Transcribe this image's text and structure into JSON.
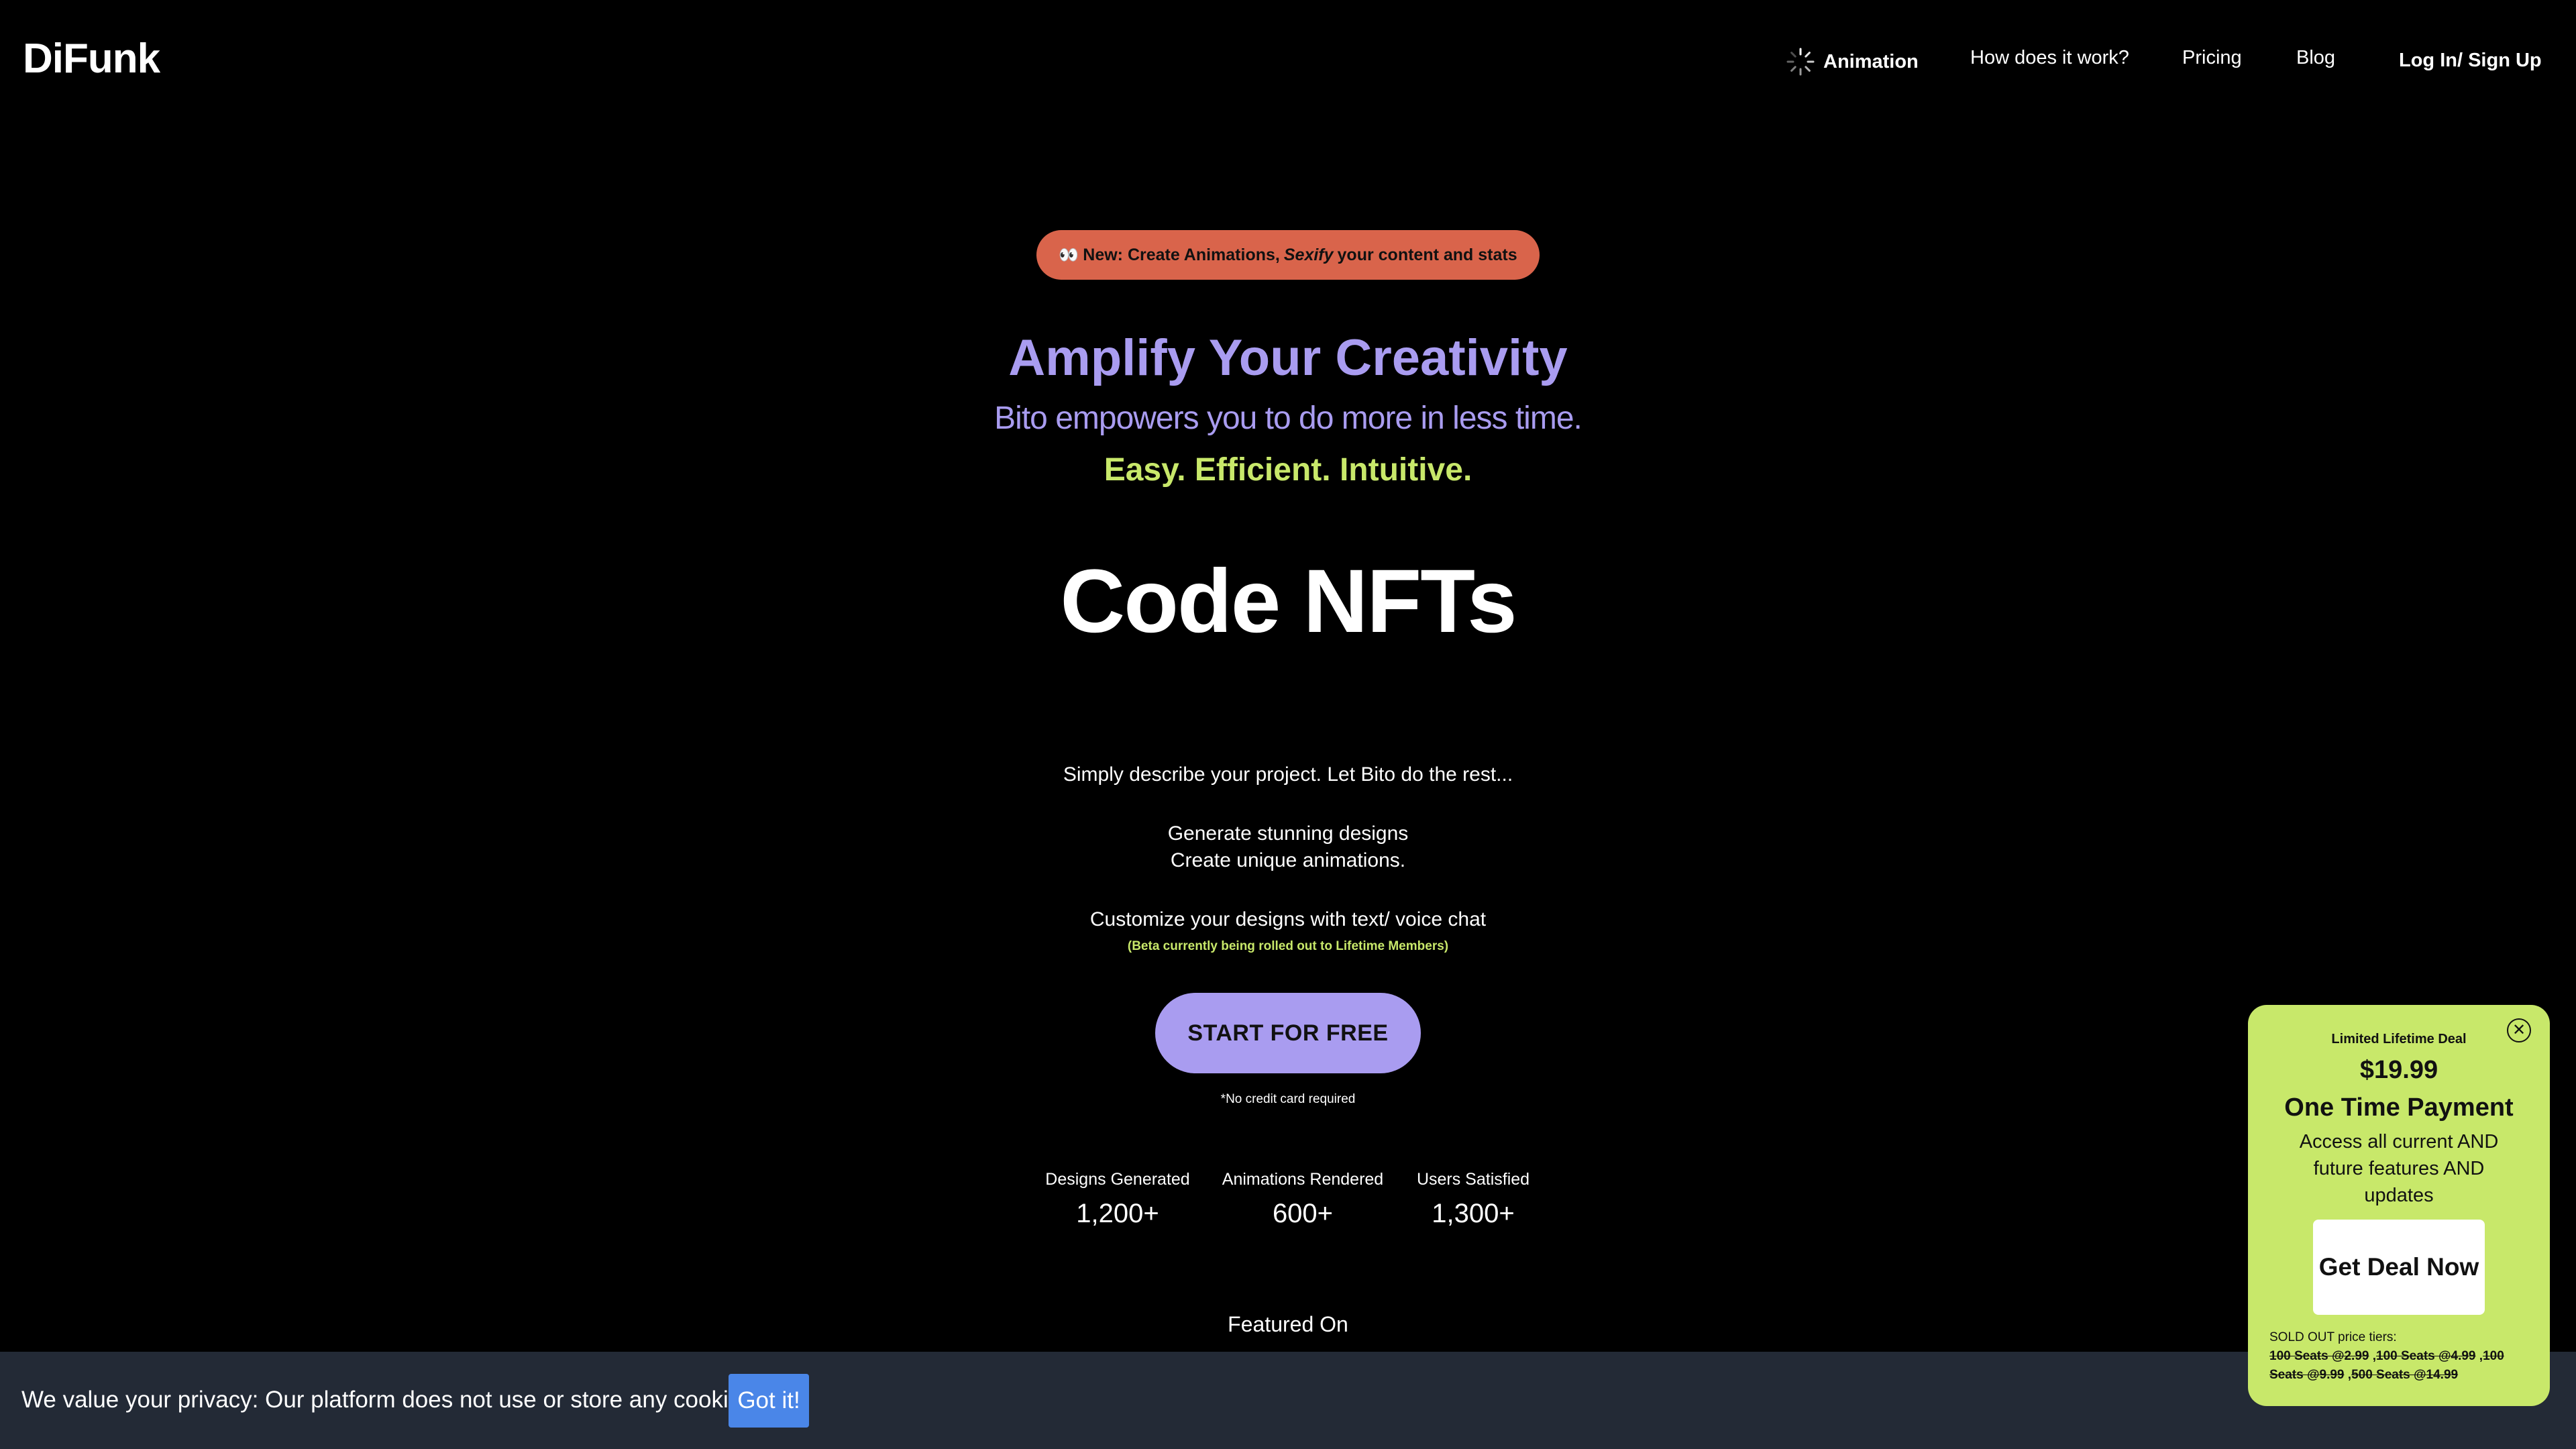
{
  "header": {
    "logo": "DiFunk",
    "nav": {
      "animation": "Animation",
      "how": "How does it work?",
      "pricing": "Pricing",
      "blog": "Blog",
      "login": "Log In/ Sign Up"
    }
  },
  "hero": {
    "pill": {
      "icon": "👀",
      "pre": "New: Create Animations,",
      "em": "Sexify",
      "post": "your content and stats"
    },
    "title": "Amplify Your Creativity",
    "subtitle": "Bito empowers you to do more in less time.",
    "tagline": "Easy. Efficient. Intuitive.",
    "rotating": "Code NFTs",
    "line1": "Simply describe your project. Let Bito do the rest...",
    "line2": "Generate stunning designs",
    "line3": "Create unique animations.",
    "line4": "Customize your designs with text/ voice chat",
    "beta": "(Beta currently being rolled out to Lifetime Members)",
    "cta": "START FOR FREE",
    "no_cc": "*No credit card required"
  },
  "stats": [
    {
      "label": "Designs Generated",
      "value": "1,200+"
    },
    {
      "label": "Animations Rendered",
      "value": "600+"
    },
    {
      "label": "Users Satisfied",
      "value": "1,300+"
    }
  ],
  "featured": "Featured On",
  "cookie": {
    "text": "We value your privacy: Our platform does not use or store any cookies.",
    "button": "Got it!"
  },
  "deal": {
    "close": "✕",
    "label": "Limited Lifetime Deal",
    "price": "$19.99",
    "payment": "One Time Payment",
    "desc": "Access all current AND future features AND updates",
    "button": "Get Deal Now",
    "sold_label": "SOLD OUT price tiers:",
    "tiers": [
      "100 Seats @2.99",
      "100 Seats @4.99",
      "100 Seats @9.99",
      "500 Seats @14.99"
    ]
  },
  "colors": {
    "accent_purple": "#a99cf0",
    "accent_green": "#c8e86a",
    "pill_orange": "#d9644b",
    "cookie_bar": "#232a36",
    "cookie_button": "#4a86e8"
  }
}
